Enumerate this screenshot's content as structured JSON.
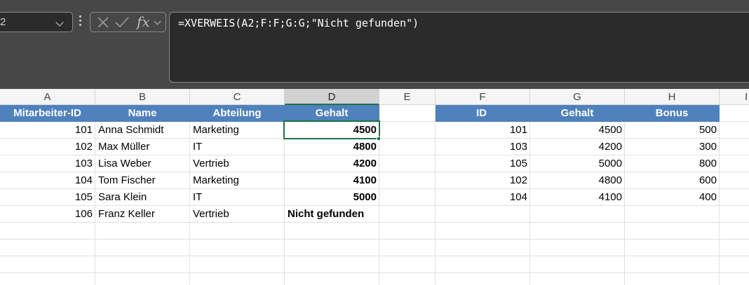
{
  "namebox": {
    "value": "2"
  },
  "formula_bar": {
    "formula": "=XVERWEIS(A2;F:F;G:G;\"Nicht gefunden\")"
  },
  "columns": [
    "A",
    "B",
    "C",
    "D",
    "E",
    "F",
    "G",
    "H",
    "I"
  ],
  "selected_column": "D",
  "employee_table": {
    "headers": [
      "Mitarbeiter-ID",
      "Name",
      "Abteilung",
      "Gehalt"
    ],
    "rows": [
      {
        "id": "101",
        "name": "Anna Schmidt",
        "dept": "Marketing",
        "salary": "4500"
      },
      {
        "id": "102",
        "name": "Max Müller",
        "dept": "IT",
        "salary": "4800"
      },
      {
        "id": "103",
        "name": "Lisa Weber",
        "dept": "Vertrieb",
        "salary": "4200"
      },
      {
        "id": "104",
        "name": "Tom Fischer",
        "dept": "Marketing",
        "salary": "4100"
      },
      {
        "id": "105",
        "name": "Sara Klein",
        "dept": "IT",
        "salary": "5000"
      },
      {
        "id": "106",
        "name": "Franz Keller",
        "dept": "Vertrieb",
        "salary": "Nicht gefunden"
      }
    ]
  },
  "lookup_table": {
    "headers": [
      "ID",
      "Gehalt",
      "Bonus"
    ],
    "rows": [
      {
        "id": "101",
        "salary": "4500",
        "bonus": "500"
      },
      {
        "id": "103",
        "salary": "4200",
        "bonus": "300"
      },
      {
        "id": "105",
        "salary": "5000",
        "bonus": "800"
      },
      {
        "id": "102",
        "salary": "4800",
        "bonus": "600"
      },
      {
        "id": "104",
        "salary": "4100",
        "bonus": "400"
      }
    ]
  },
  "colors": {
    "header_fill": "#4f81bd",
    "selection": "#217346",
    "ribbon_dark": "#474747"
  }
}
